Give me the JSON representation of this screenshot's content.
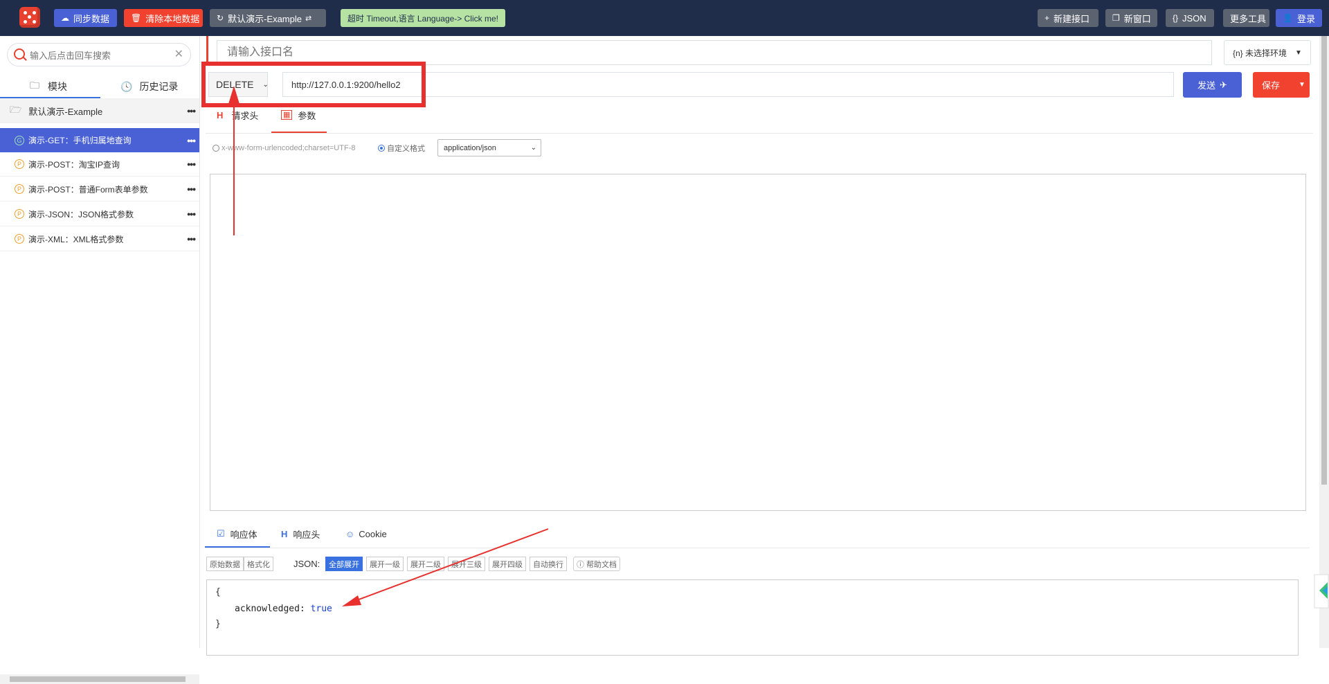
{
  "topbar": {
    "sync_label": "同步数据",
    "clear_label": "清除本地数据",
    "project_label": "默认演示-Example",
    "timeout_label": "超时 Timeout,语言 Language-> Click me!",
    "new_api_label": "新建接口",
    "new_window_label": "新窗口",
    "json_label": "JSON",
    "more_tools_label": "更多工具",
    "login_label": "登录"
  },
  "sidebar": {
    "search_placeholder": "输入后点击回车搜索",
    "tab_module": "模块",
    "tab_history": "历史记录",
    "group_name": "默认演示-Example",
    "items": [
      {
        "badge": "G",
        "label": "演示-GET：手机归属地查询"
      },
      {
        "badge": "P",
        "label": "演示-POST：淘宝IP查询"
      },
      {
        "badge": "P",
        "label": "演示-POST：普通Form表单参数"
      },
      {
        "badge": "P",
        "label": "演示-JSON：JSON格式参数"
      },
      {
        "badge": "P",
        "label": "演示-XML：XML格式参数"
      }
    ]
  },
  "request": {
    "name_placeholder": "请输入接口名",
    "env_label": "{n} 未选择环境",
    "method": "DELETE",
    "url": "http://127.0.0.1:9200/hello2",
    "send_label": "发送",
    "save_label": "保存",
    "tab_headers": "请求头",
    "tab_params": "参数",
    "radio_form": "x-www-form-urlencoded;charset=UTF-8",
    "radio_custom": "自定义格式",
    "content_type": "application/json"
  },
  "response": {
    "tab_body": "响应体",
    "tab_headers": "响应头",
    "tab_cookie": "Cookie",
    "raw_label": "原始数据",
    "format_label": "格式化",
    "json_label": "JSON:",
    "expand_all": "全部展开",
    "expand_1": "展开一级",
    "expand_2": "展开二级",
    "expand_3": "展开三级",
    "expand_4": "展开四级",
    "auto_wrap": "自动换行",
    "help_doc": "帮助文档",
    "json_open": "{",
    "json_key": "acknowledged",
    "json_value": "true",
    "json_close": "}"
  },
  "colors": {
    "topbar_bg": "#1f2d4b",
    "primary": "#4a61d6",
    "danger": "#f0422f",
    "annotation_red": "#e8312f"
  }
}
